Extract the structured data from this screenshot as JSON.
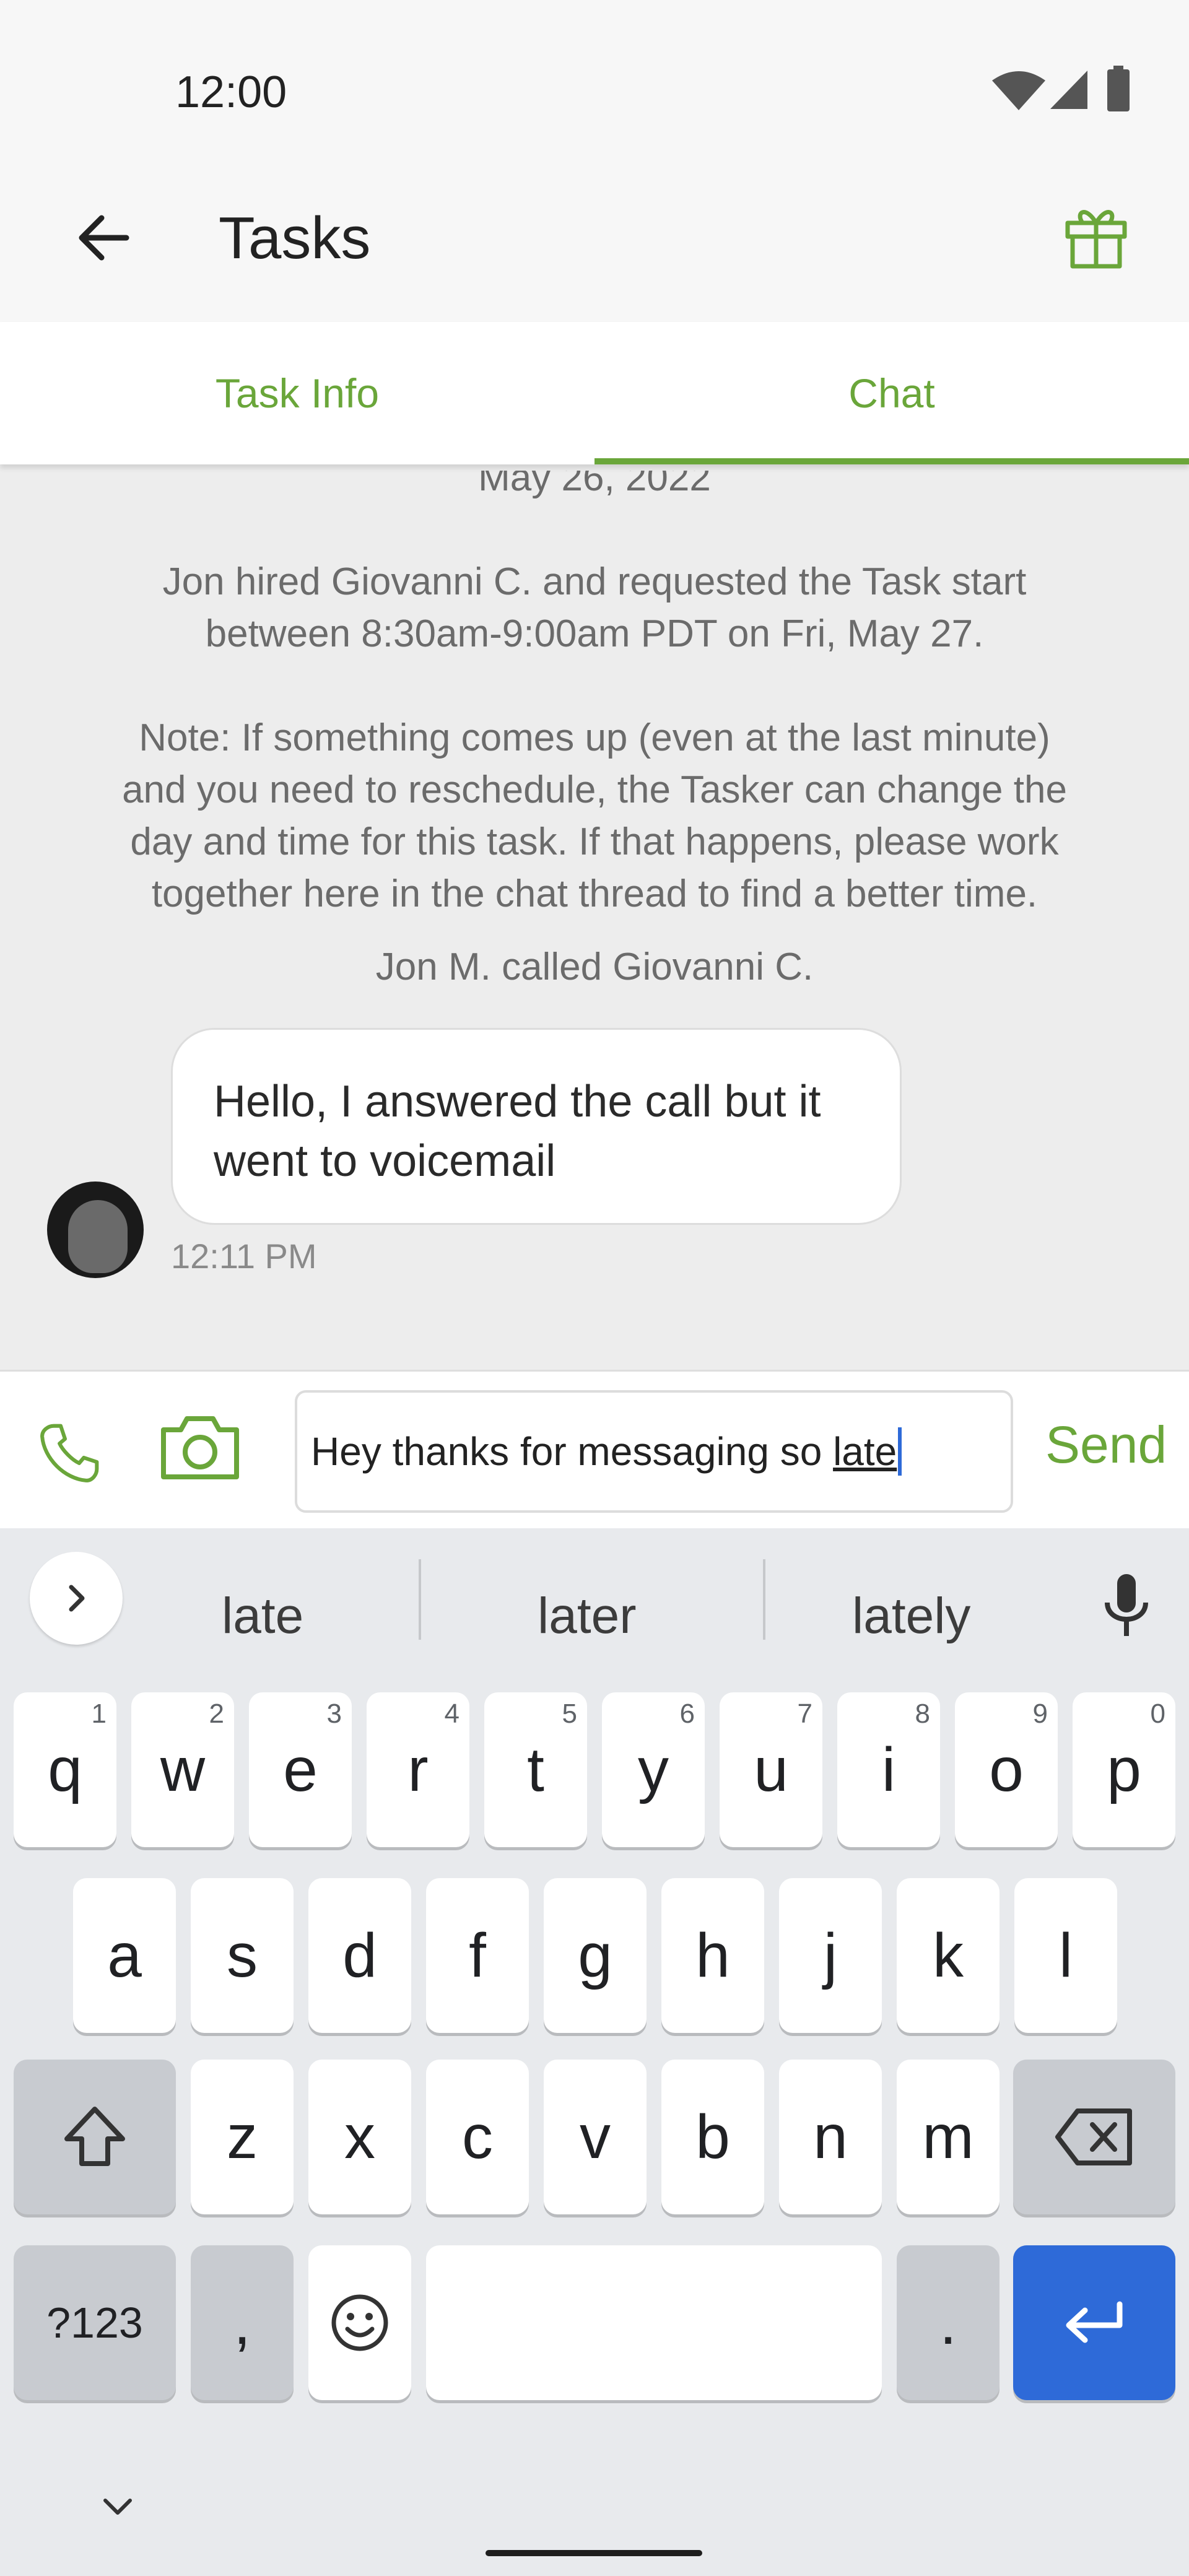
{
  "status_bar": {
    "time": "12:00",
    "icons": [
      "wifi-icon",
      "signal-icon",
      "battery-icon"
    ]
  },
  "app_bar": {
    "title": "Tasks",
    "back_icon": "arrow-left-icon",
    "gift_icon": "gift-icon"
  },
  "tabs": [
    {
      "label": "Task Info",
      "active": false
    },
    {
      "label": "Chat",
      "active": true
    }
  ],
  "chat": {
    "date_label": "May 26, 2022",
    "system_hired": [
      "Jon hired Giovanni C. and requested the Task start",
      "between 8:30am-9:00am PDT on Fri, May 27."
    ],
    "system_note": [
      "Note: If something comes up (even at the last minute)",
      "and you need to reschedule, the Tasker can change the",
      "day and time for this task. If that happens, please work",
      "together here in the chat thread to find a better time."
    ],
    "call_event": "Jon M. called Giovanni C.",
    "message": {
      "lines": [
        "Hello, I answered the call but it",
        "went to voicemail"
      ],
      "time": "12:11 PM"
    }
  },
  "composer": {
    "input_value_prefix": "Hey thanks for messaging so ",
    "input_value_word": "late",
    "send_label": "Send",
    "phone_icon": "phone-icon",
    "camera_icon": "camera-icon"
  },
  "keyboard": {
    "suggestions": [
      "late",
      "later",
      "lately"
    ],
    "row1": [
      [
        "q",
        "1"
      ],
      [
        "w",
        "2"
      ],
      [
        "e",
        "3"
      ],
      [
        "r",
        "4"
      ],
      [
        "t",
        "5"
      ],
      [
        "y",
        "6"
      ],
      [
        "u",
        "7"
      ],
      [
        "i",
        "8"
      ],
      [
        "o",
        "9"
      ],
      [
        "p",
        "0"
      ]
    ],
    "row2": [
      "a",
      "s",
      "d",
      "f",
      "g",
      "h",
      "j",
      "k",
      "l"
    ],
    "row3": [
      "z",
      "x",
      "c",
      "v",
      "b",
      "n",
      "m"
    ],
    "symbols_label": "?123",
    "comma_label": ",",
    "period_label": ".",
    "accent_color": "#2e6ad8"
  },
  "colors": {
    "brand_green": "#6aa63a"
  }
}
